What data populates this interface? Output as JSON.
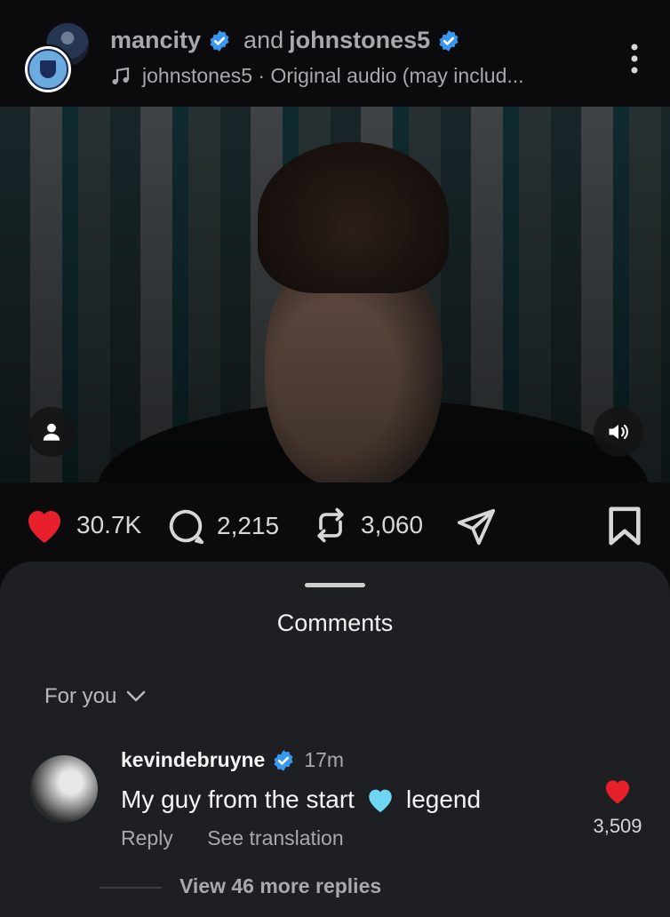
{
  "header": {
    "account1": "mancity",
    "connector": "and",
    "account2": "johnstones5",
    "audio_text": "johnstones5 · Original audio (may includ..."
  },
  "actions": {
    "likes": "30.7K",
    "comments": "2,215",
    "reposts": "3,060"
  },
  "comments_sheet": {
    "title": "Comments",
    "filter": "For you",
    "comment": {
      "username": "kevindebruyne",
      "time": "17m",
      "text_before": "My guy from the start",
      "emoji": "🩵",
      "text_after": "legend",
      "reply_label": "Reply",
      "translate_label": "See translation",
      "like_count": "3,509"
    },
    "view_replies": "View 46 more replies"
  },
  "colors": {
    "like_red": "#e8202b",
    "verified_blue": "#3897f0"
  }
}
